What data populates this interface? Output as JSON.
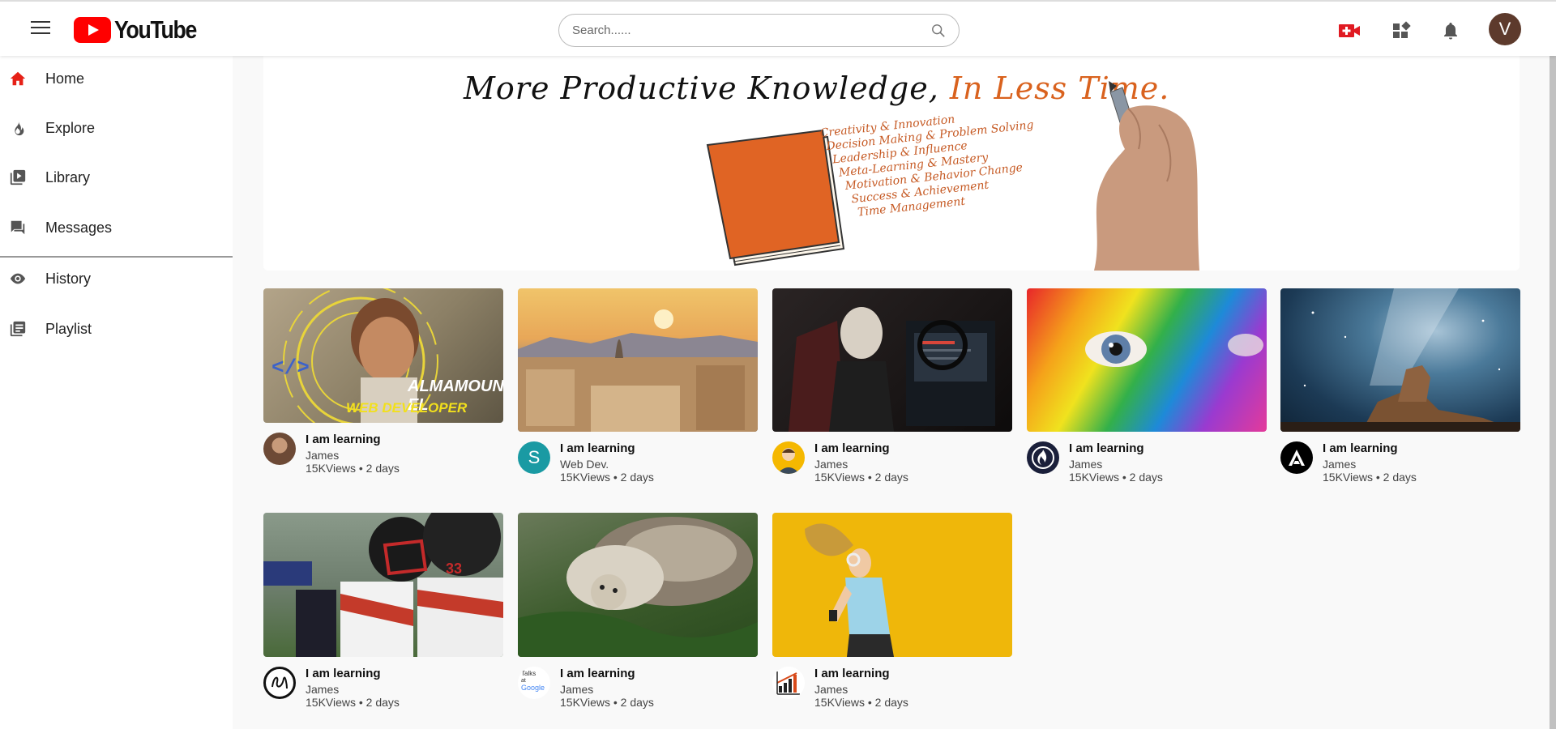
{
  "header": {
    "logo_text": "YouTube",
    "search_placeholder": "Search......",
    "avatar_letter": "V"
  },
  "sidebar": {
    "items": [
      {
        "label": "Home"
      },
      {
        "label": "Explore"
      },
      {
        "label": "Library"
      },
      {
        "label": "Messages"
      },
      {
        "label": "History"
      },
      {
        "label": "Playlist"
      }
    ]
  },
  "banner": {
    "title_main": "More Productive Knowledge,",
    "title_highlight": "In Less Time.",
    "topics": [
      "Creativity & Innovation",
      "Decision Making & Problem Solving",
      "Leadership & Influence",
      "Meta-Learning & Mastery",
      "Motivation & Behavior Change",
      "Success & Achievement",
      "Time Management"
    ]
  },
  "videos": [
    {
      "title": "I am learning",
      "channel": "James",
      "stats": "15KViews • 2 days",
      "thumb_text_1": "ALMAMOUN EL",
      "thumb_text_2": "WEB DEVELOPER"
    },
    {
      "title": "I am learning",
      "channel": "Web Dev.",
      "stats": "15KViews • 2 days",
      "avatar_letter": "S"
    },
    {
      "title": "I am learning",
      "channel": "James",
      "stats": "15KViews • 2 days"
    },
    {
      "title": "I am learning",
      "channel": "James",
      "stats": "15KViews • 2 days"
    },
    {
      "title": "I am learning",
      "channel": "James",
      "stats": "15KViews • 2 days"
    },
    {
      "title": "I am learning",
      "channel": "James",
      "stats": "15KViews • 2 days"
    },
    {
      "title": "I am learning",
      "channel": "James",
      "stats": "15KViews • 2 days",
      "avatar_text_1": "Talks",
      "avatar_text_2": "at",
      "avatar_text_3": "Google"
    },
    {
      "title": "I am learning",
      "channel": "James",
      "stats": "15KViews • 2 days"
    }
  ],
  "colors": {
    "brand_red": "#ff0000",
    "accent_orange": "#d9621e",
    "channel_teal": "#1a9aa3"
  }
}
